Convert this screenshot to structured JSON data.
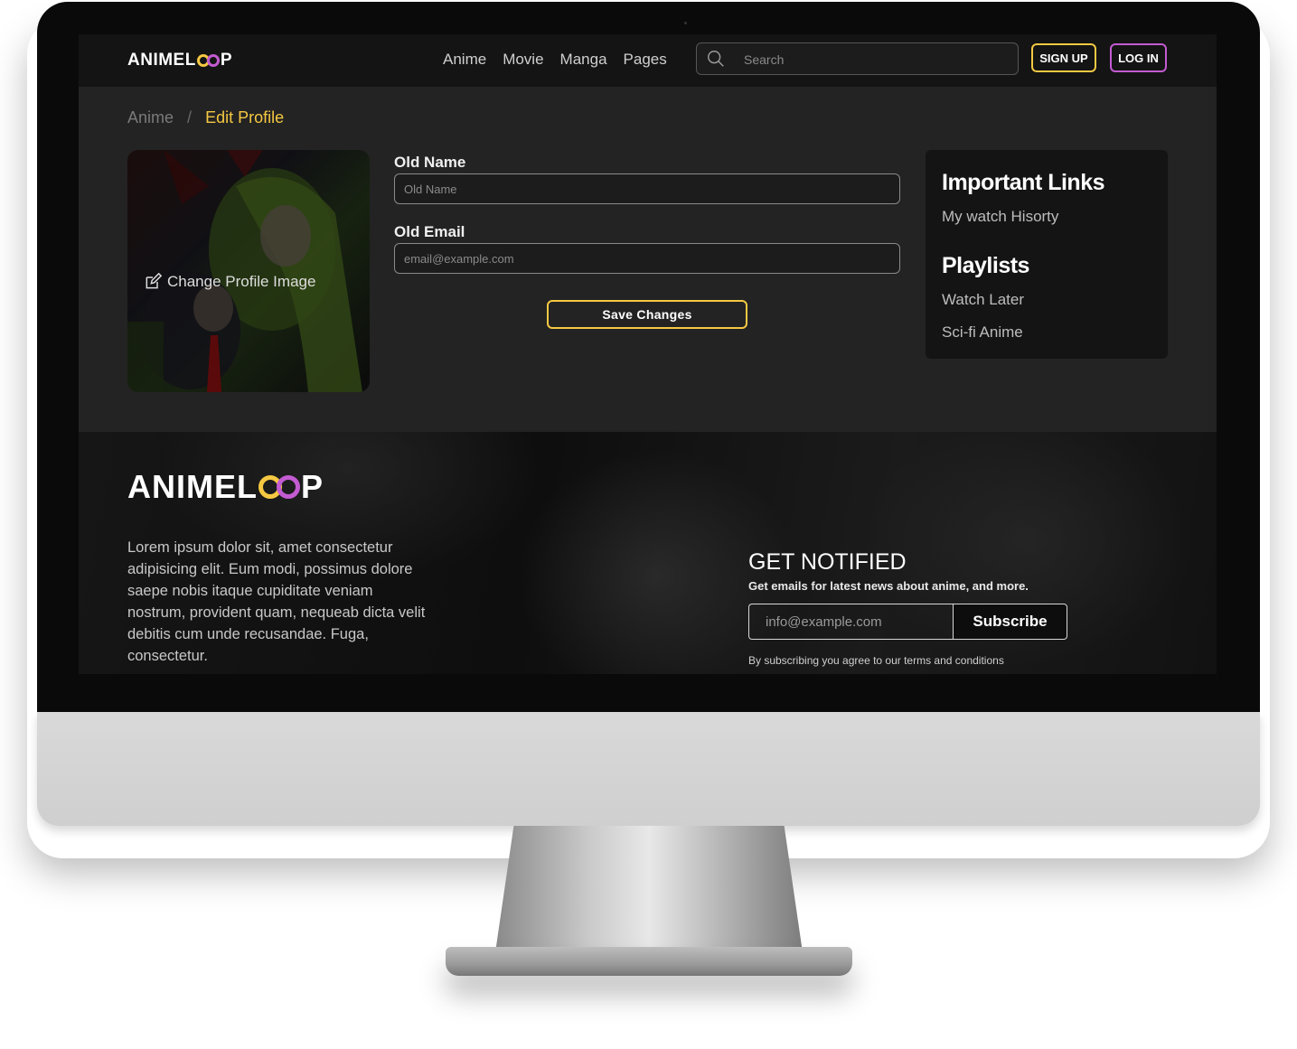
{
  "brand": {
    "name_left": "ANIMEL",
    "name_right": "P"
  },
  "nav": {
    "links": [
      "Anime",
      "Movie",
      "Manga",
      "Pages"
    ],
    "search_placeholder": "Search",
    "signup_label": "SIGN UP",
    "login_label": "LOG IN"
  },
  "breadcrumb": {
    "root": "Anime",
    "separator": "/",
    "current": "Edit Profile"
  },
  "profile": {
    "change_image_label": "Change Profile Image"
  },
  "form": {
    "name_label": "Old Name",
    "name_placeholder": "Old Name",
    "email_label": "Old Email",
    "email_placeholder": "email@example.com",
    "save_label": "Save Changes"
  },
  "sidebar": {
    "links_title": "Important Links",
    "links": [
      "My watch Hisorty"
    ],
    "playlists_title": "Playlists",
    "playlists": [
      "Watch Later",
      "Sci-fi Anime"
    ]
  },
  "footer": {
    "description": "Lorem ipsum dolor sit, amet consectetur adipisicing elit. Eum modi, possimus dolore saepe nobis itaque cupiditate veniam nostrum, provident quam, nequeab dicta velit debitis cum unde recusandae. Fuga, consectetur.",
    "notify_title": "GET NOTIFIED",
    "notify_subtitle": "Get emails for latest news about anime, and more.",
    "email_placeholder": "info@example.com",
    "subscribe_label": "Subscribe",
    "terms": "By subscribing you agree to our terms and conditions"
  },
  "colors": {
    "accent_yellow": "#f5c842",
    "accent_purple": "#c35bd1",
    "background": "#232323",
    "navbar": "#141414"
  }
}
